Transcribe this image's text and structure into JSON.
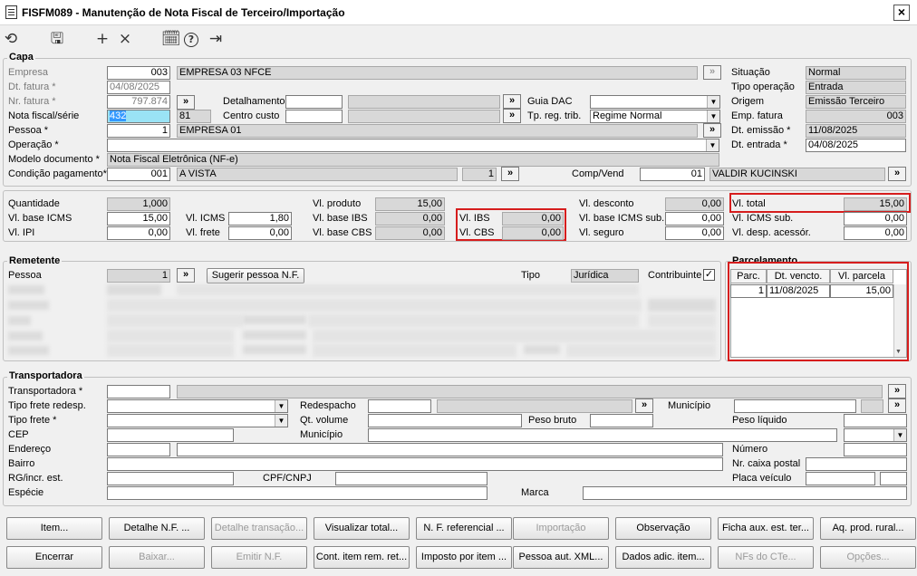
{
  "window": {
    "title": "FISFM089 - Manutenção de Nota Fiscal de Terceiro/Importação",
    "close": "×"
  },
  "toolbar": {
    "undo": "⟲",
    "save": "🖫",
    "add": "+",
    "delete": "×",
    "calendar": "🗓",
    "help": "?",
    "exit": "⇥"
  },
  "capa": {
    "title": "Capa",
    "empresa": {
      "label": "Empresa",
      "code": "003",
      "name": "EMPRESA 03 NFCE"
    },
    "dt_fatura": {
      "label": "Dt. fatura *",
      "value": "04/08/2025"
    },
    "nr_fatura": {
      "label": "Nr. fatura *",
      "value": "797.874"
    },
    "nota_fiscal": {
      "label": "Nota fiscal/série",
      "value": "432",
      "serie": "81"
    },
    "pessoa": {
      "label": "Pessoa *",
      "code": "1",
      "name": "EMPRESA 01"
    },
    "operacao": {
      "label": "Operação *"
    },
    "modelo_doc": {
      "label": "Modelo documento *",
      "value": "Nota Fiscal Eletrônica (NF-e)"
    },
    "cond_pag": {
      "label": "Condição pagamento*",
      "code": "001",
      "name": "A VISTA",
      "qty": "1"
    },
    "detalhamento": {
      "label": "Detalhamento"
    },
    "centro_custo": {
      "label": "Centro custo"
    },
    "guia_dac": {
      "label": "Guia DAC"
    },
    "tp_reg_trib": {
      "label": "Tp. reg. trib.",
      "value": "Regime Normal"
    },
    "comp_vend": {
      "label": "Comp/Vend",
      "code": "01",
      "name": "VALDIR KUCINSKI"
    },
    "situacao": {
      "label": "Situação",
      "value": "Normal"
    },
    "tipo_operacao": {
      "label": "Tipo operação",
      "value": "Entrada"
    },
    "origem": {
      "label": "Origem",
      "value": "Emissão Terceiro"
    },
    "emp_fatura": {
      "label": "Emp. fatura",
      "value": "003"
    },
    "dt_emissao": {
      "label": "Dt. emissão *",
      "value": "11/08/2025"
    },
    "dt_entrada": {
      "label": "Dt. entrada *",
      "value": "04/08/2025"
    }
  },
  "totais": {
    "quantidade": {
      "label": "Quantidade",
      "value": "1,000"
    },
    "vl_base_icms": {
      "label": "Vl. base ICMS",
      "value": "15,00"
    },
    "vl_ipi": {
      "label": "Vl. IPI",
      "value": "0,00"
    },
    "vl_icms": {
      "label": "Vl. ICMS",
      "value": "1,80"
    },
    "vl_frete": {
      "label": "Vl. frete",
      "value": "0,00"
    },
    "vl_produto": {
      "label": "Vl. produto",
      "value": "15,00"
    },
    "vl_base_ibs": {
      "label": "Vl. base IBS",
      "value": "0,00"
    },
    "vl_base_cbs": {
      "label": "Vl. base CBS",
      "value": "0,00"
    },
    "vl_ibs": {
      "label": "Vl. IBS",
      "value": "0,00"
    },
    "vl_cbs": {
      "label": "Vl. CBS",
      "value": "0,00"
    },
    "vl_desconto": {
      "label": "Vl. desconto",
      "value": "0,00"
    },
    "vl_base_icms_sub": {
      "label": "Vl. base ICMS sub.",
      "value": "0,00"
    },
    "vl_seguro": {
      "label": "Vl. seguro",
      "value": "0,00"
    },
    "vl_total": {
      "label": "Vl. total",
      "value": "15,00"
    },
    "vl_icms_sub": {
      "label": "Vl. ICMS sub.",
      "value": "0,00"
    },
    "vl_desp_acessor": {
      "label": "Vl. desp. acessór.",
      "value": "0,00"
    }
  },
  "remetente": {
    "title": "Remetente",
    "pessoa": {
      "label": "Pessoa",
      "code": "1"
    },
    "sugerir": "Sugerir pessoa N.F.",
    "tipo": {
      "label": "Tipo",
      "value": "Jurídica"
    },
    "contribuinte": {
      "label": "Contribuinte",
      "checked": "✓"
    }
  },
  "parcelamento": {
    "title": "Parcelamento",
    "headers": [
      "Parc.",
      "Dt. vencto.",
      "Vl. parcela"
    ],
    "rows": [
      {
        "parc": "1",
        "vencto": "11/08/2025",
        "valor": "15,00"
      }
    ]
  },
  "transportadora": {
    "title": "Transportadora",
    "transportadora": "Transportadora *",
    "tipo_frete_redesp": "Tipo frete redesp.",
    "tipo_frete": "Tipo frete *",
    "cep": "CEP",
    "endereco": "Endereço",
    "bairro": "Bairro",
    "rg": "RG/incr. est.",
    "especie": "Espécie",
    "redespacho": "Redespacho",
    "qt_volume": "Qt. volume",
    "municipio": "Município",
    "municipio2": "Município",
    "peso_bruto": "Peso bruto",
    "peso_liquido": "Peso líquido",
    "numero": "Número",
    "nr_caixa_postal": "Nr. caixa postal",
    "placa_veiculo": "Placa veículo",
    "cpf_cnpj": "CPF/CNPJ",
    "marca": "Marca"
  },
  "buttons_row1": [
    "Item...",
    "Detalhe N.F. ...",
    "Detalhe transação...",
    "Visualizar total...",
    "N. F. referencial ...",
    "Importação",
    "Observação",
    "Ficha aux. est. ter...",
    "Aq. prod. rural..."
  ],
  "buttons_row2": [
    "Encerrar",
    "Baixar...",
    "Emitir N.F.",
    "Cont. item rem. ret...",
    "Imposto por item ...",
    "Pessoa aut. XML...",
    "Dados adic. item...",
    "NFs do CTe...",
    "Opções..."
  ],
  "arrow": "»",
  "caret": "▼"
}
